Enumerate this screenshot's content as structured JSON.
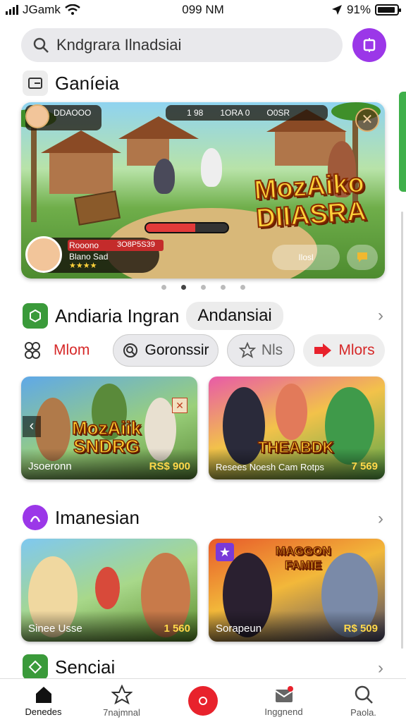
{
  "status_bar": {
    "carrier": "JGamk",
    "time": "099 NM",
    "battery_percent": "91%",
    "battery_level": 0.91
  },
  "search": {
    "placeholder": "Kndgrara Ilnadsiai"
  },
  "sections": {
    "featured": {
      "title": "Ganíeia"
    },
    "categories": {
      "title": "Andiaria Ingran",
      "badge": "Andansiai"
    },
    "second": {
      "title": "Imanesian"
    },
    "third": {
      "title": "Senciai"
    }
  },
  "hero": {
    "title_line1": "MozAiko",
    "title_line2": "DIIASRA",
    "hud_top_left": "DDAOOO",
    "hud_stat_1": "1 98",
    "hud_stat_2": "1ORA 0",
    "hud_stat_3": "O0SR",
    "player_name": "Rooono",
    "player_sub": "Blano Sad",
    "player_stats": "3O8P5S39",
    "rating": "★★★★",
    "reward_label": "Ilosl",
    "health_level": 0.6,
    "page_count": 5,
    "active_page": 2
  },
  "chips": [
    {
      "label": "Mlom",
      "icon": "people-icon"
    },
    {
      "label": "Goronssir",
      "icon": "search-icon"
    },
    {
      "label": "Nls",
      "icon": "star-icon"
    },
    {
      "label": "Mlors",
      "icon": "arrow-icon"
    }
  ],
  "cards_row1": [
    {
      "name": "Jsoeronn",
      "price": "RS$ 900",
      "logo_line1": "MozAiik",
      "logo_line2": "SNDRG"
    },
    {
      "name": "Resees Noesh Cam Rotps",
      "price": "7 569",
      "logo_line1": "THEABDK",
      "logo_line2": ""
    }
  ],
  "cards_row2": [
    {
      "name": "Sinee Usse",
      "price": "1 560",
      "logo_line1": "",
      "logo_line2": ""
    },
    {
      "name": "Sorapeun",
      "price": "R$ 509",
      "logo_line1": "MAGGON",
      "logo_line2": "FAMIE"
    }
  ],
  "bottom_nav": [
    {
      "label": "Denedes",
      "icon": "home-icon"
    },
    {
      "label": "7najmnal",
      "icon": "star-icon"
    },
    {
      "label": "",
      "icon": "record-icon"
    },
    {
      "label": "Inggnend",
      "icon": "mail-icon"
    },
    {
      "label": "Paola.",
      "icon": "search-icon"
    }
  ],
  "colors": {
    "accent_purple": "#9b37e8",
    "accent_red": "#e8222c",
    "accent_green": "#3fb04a",
    "chip_bg": "#e9e9ec"
  }
}
